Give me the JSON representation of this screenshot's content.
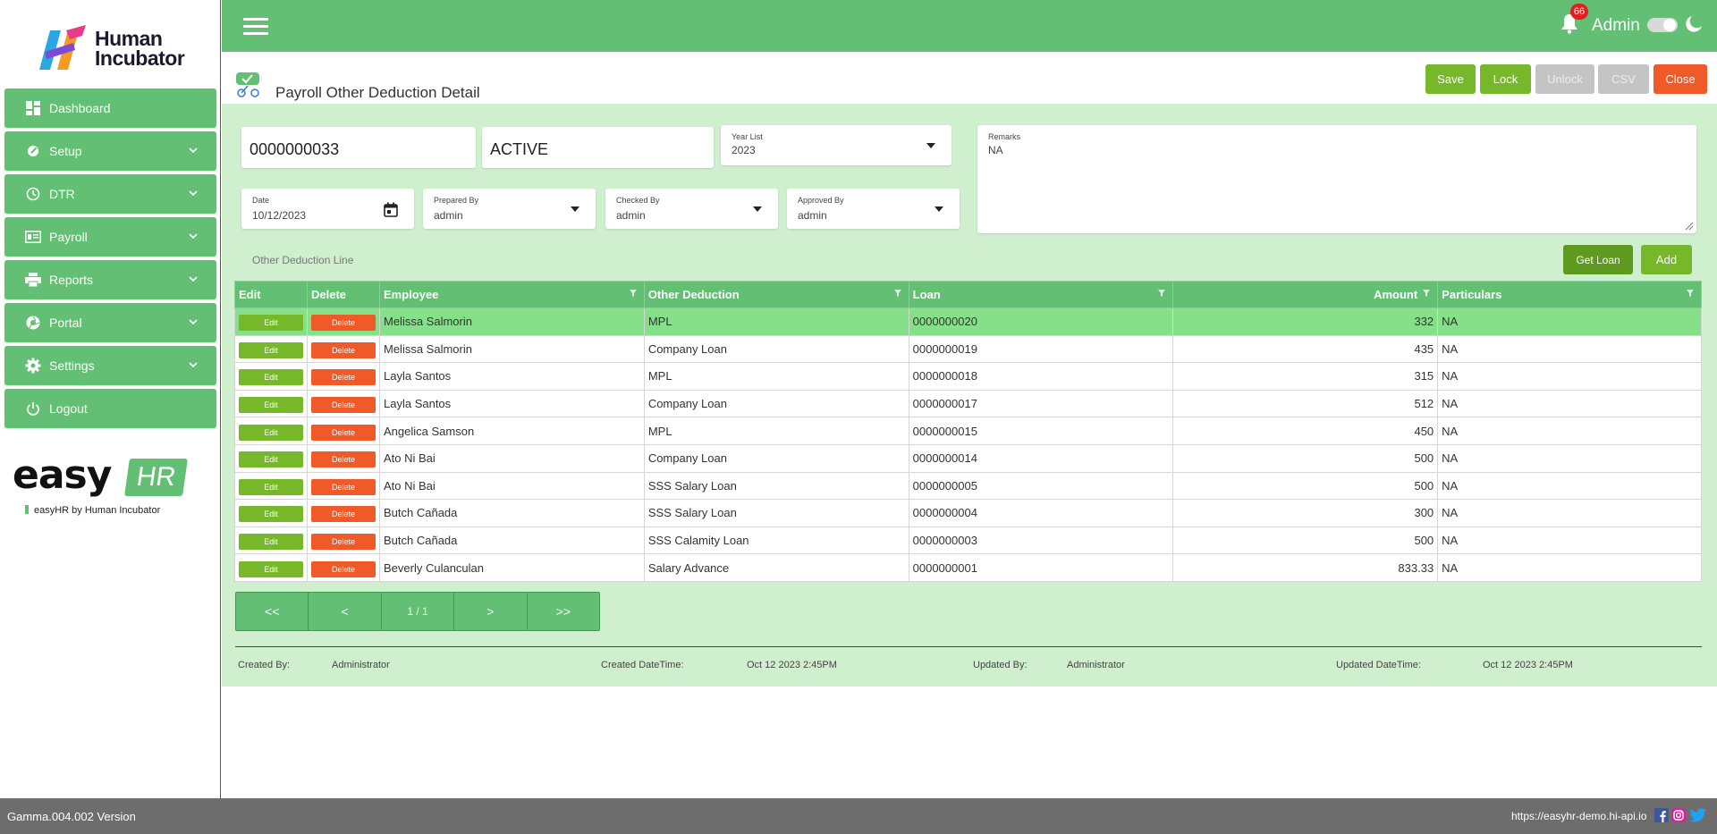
{
  "brand": {
    "name_line1": "Human",
    "name_line2": "Incubator",
    "easy": "easy",
    "hr": "HR",
    "tagline": "easyHR by Human Incubator"
  },
  "sidebar": {
    "items": [
      {
        "label": "Dashboard",
        "icon": "dashboard-icon"
      },
      {
        "label": "Setup",
        "icon": "wrench-icon"
      },
      {
        "label": "DTR",
        "icon": "clock-icon"
      },
      {
        "label": "Payroll",
        "icon": "payroll-icon"
      },
      {
        "label": "Reports",
        "icon": "printer-icon"
      },
      {
        "label": "Portal",
        "icon": "aperture-icon"
      },
      {
        "label": "Settings",
        "icon": "gear-icon"
      },
      {
        "label": "Logout",
        "icon": "power-icon"
      }
    ]
  },
  "header": {
    "notification_count": "66",
    "user": "Admin"
  },
  "page": {
    "title": "Payroll Other Deduction Detail"
  },
  "toolbar": {
    "save": "Save",
    "lock": "Lock",
    "unlock": "Unlock",
    "csv": "CSV",
    "close": "Close"
  },
  "form": {
    "number": "0000000033",
    "status": "ACTIVE",
    "year_label": "Year List",
    "year_value": "2023",
    "remarks_label": "Remarks",
    "remarks_value": "NA",
    "date_label": "Date",
    "date_value": "10/12/2023",
    "prepared_label": "Prepared By",
    "prepared_value": "admin",
    "checked_label": "Checked By",
    "checked_value": "admin",
    "approved_label": "Approved By",
    "approved_value": "admin"
  },
  "lines": {
    "section_label": "Other Deduction Line",
    "get_loan": "Get Loan",
    "add": "Add",
    "columns": {
      "edit": "Edit",
      "delete": "Delete",
      "employee": "Employee",
      "other_deduction": "Other Deduction",
      "loan": "Loan",
      "amount": "Amount",
      "particulars": "Particulars"
    },
    "edit_label": "Edit",
    "delete_label": "Delete",
    "rows": [
      {
        "employee": "Melissa Salmorin",
        "deduction": "MPL",
        "loan": "0000000020",
        "amount": "332",
        "particulars": "NA"
      },
      {
        "employee": "Melissa Salmorin",
        "deduction": "Company Loan",
        "loan": "0000000019",
        "amount": "435",
        "particulars": "NA"
      },
      {
        "employee": "Layla Santos",
        "deduction": "MPL",
        "loan": "0000000018",
        "amount": "315",
        "particulars": "NA"
      },
      {
        "employee": "Layla Santos",
        "deduction": "Company Loan",
        "loan": "0000000017",
        "amount": "512",
        "particulars": "NA"
      },
      {
        "employee": "Angelica Samson",
        "deduction": "MPL",
        "loan": "0000000015",
        "amount": "450",
        "particulars": "NA"
      },
      {
        "employee": "Ato Ni Bai",
        "deduction": "Company Loan",
        "loan": "0000000014",
        "amount": "500",
        "particulars": "NA"
      },
      {
        "employee": "Ato Ni Bai",
        "deduction": "SSS Salary Loan",
        "loan": "0000000005",
        "amount": "500",
        "particulars": "NA"
      },
      {
        "employee": "Butch Cañada",
        "deduction": "SSS Salary Loan",
        "loan": "0000000004",
        "amount": "300",
        "particulars": "NA"
      },
      {
        "employee": "Butch Cañada",
        "deduction": "SSS Calamity Loan",
        "loan": "0000000003",
        "amount": "500",
        "particulars": "NA"
      },
      {
        "employee": "Beverly Culanculan",
        "deduction": "Salary Advance",
        "loan": "0000000001",
        "amount": "833.33",
        "particulars": "NA"
      }
    ]
  },
  "pager": {
    "first": "<<",
    "prev": "<",
    "info": "1 / 1",
    "next": ">",
    "last": ">>"
  },
  "audit": {
    "created_by_label": "Created By:",
    "created_by": "Administrator",
    "created_dt_label": "Created DateTime:",
    "created_dt": "Oct 12 2023 2:45PM",
    "updated_by_label": "Updated By:",
    "updated_by": "Administrator",
    "updated_dt_label": "Updated DateTime:",
    "updated_dt": "Oct 12 2023 2:45PM"
  },
  "footer": {
    "version": "Gamma.004.002 Version",
    "url": "https://easyhr-demo.hi-api.io"
  },
  "colors": {
    "primary_green": "#63bf74",
    "action_green": "#76b82a",
    "danger": "#f05a28",
    "panel_bg": "#d0efcf"
  }
}
